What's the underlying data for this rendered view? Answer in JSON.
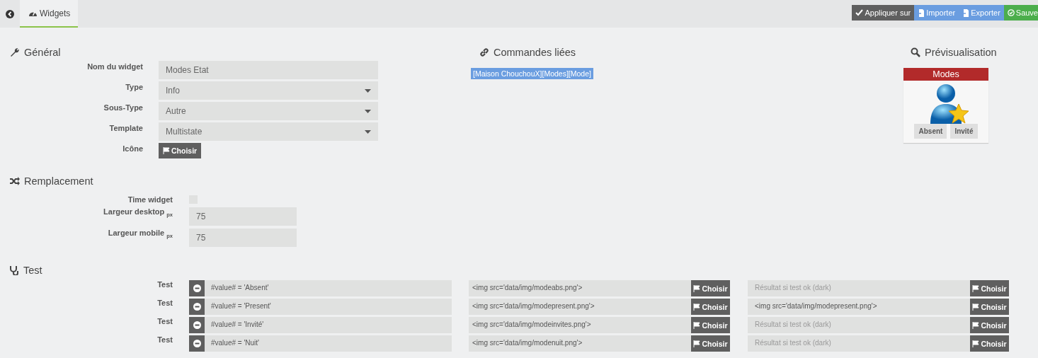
{
  "tabs": [
    {
      "label": "Widgets",
      "selected": true
    }
  ],
  "actions": [
    {
      "label": "Appliquer sur",
      "kind": "apply"
    },
    {
      "label": "Importer",
      "kind": "import"
    },
    {
      "label": "Exporter",
      "kind": "export"
    },
    {
      "label": "Sauve",
      "kind": "save"
    }
  ],
  "general": {
    "title": "Général",
    "fields": [
      {
        "label": "Nom du widget",
        "kind": "text",
        "value": "Modes Etat"
      },
      {
        "label": "Type",
        "kind": "select",
        "value": "Info"
      },
      {
        "label": "Sous-Type",
        "kind": "select",
        "value": "Autre"
      },
      {
        "label": "Template",
        "kind": "select",
        "value": "Multistate"
      },
      {
        "label": "Icône",
        "kind": "button",
        "value": "Choisir"
      }
    ]
  },
  "linked": {
    "title": "Commandes liées",
    "commands": [
      "[Maison ChouchouX][Modes][Mode]"
    ]
  },
  "preview": {
    "title": "Prévisualisation",
    "widget_title": "Modes",
    "buttons": [
      "Absent",
      "Invité"
    ]
  },
  "replacement": {
    "title": "Remplacement",
    "time_widget": {
      "label": "Time widget",
      "checked": false
    },
    "widths": [
      {
        "label": "Largeur desktop",
        "unit": "px",
        "value": "75"
      },
      {
        "label": "Largeur mobile",
        "unit": "px",
        "value": "75"
      }
    ]
  },
  "test": {
    "title": "Test",
    "rows": [
      {
        "label": "Test",
        "condition": "#value# = 'Absent'",
        "result": {
          "value": "<img src='data/img/modeabs.png'>"
        },
        "result_dark": {
          "placeholder": "Résultat si test ok (dark)"
        },
        "button": "Choisir",
        "button_dark": "Choisir"
      },
      {
        "label": "Test",
        "condition": "#value# = 'Present'",
        "result": {
          "value": "<img src='data/img/modepresent.png'>"
        },
        "result_dark": {
          "value": "<img src='data/img/modepresent.png'>"
        },
        "button": "Choisir",
        "button_dark": "Choisir"
      },
      {
        "label": "Test",
        "condition": "#value# = 'Invité'",
        "result": {
          "value": "<img src='data/img/modeinvites.png'>"
        },
        "result_dark": {
          "placeholder": "Résultat si test ok (dark)"
        },
        "button": "Choisir",
        "button_dark": "Choisir"
      },
      {
        "label": "Test",
        "condition": "#value# = 'Nuit'",
        "result": {
          "value": "<img src='data/img/modenuit.png'>"
        },
        "result_dark": {
          "placeholder": "Résultat si test ok (dark)"
        },
        "button": "Choisir",
        "button_dark": "Choisir"
      }
    ]
  }
}
